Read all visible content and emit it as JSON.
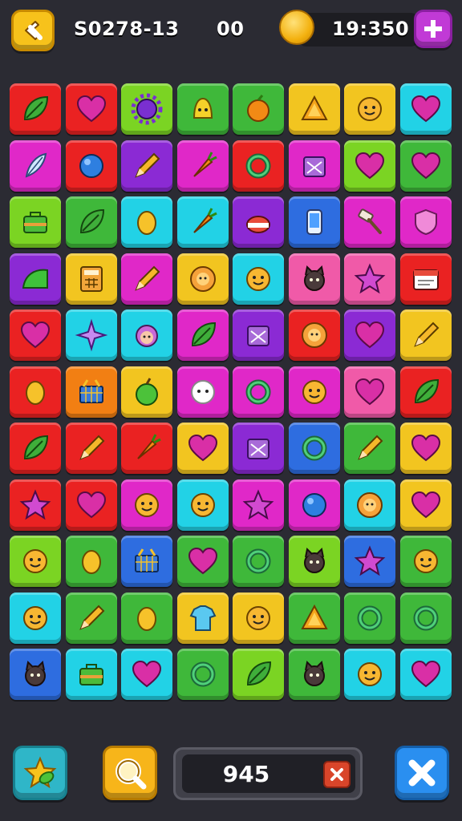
{
  "header": {
    "left_code": "S0278-13",
    "mid_value": "00",
    "coins": "19:350"
  },
  "footer": {
    "score": "945"
  },
  "colors": {
    "red": "#ea2222",
    "magenta": "#e028c8",
    "lime": "#7bd423",
    "green": "#3fb83a",
    "yellow": "#f2c520",
    "cyan": "#22d2e6",
    "purple": "#8b2ad4",
    "orange": "#f27f13",
    "blue": "#2e6de0",
    "pink": "#f05aa8"
  },
  "board": {
    "rows": [
      [
        {
          "bg": "red",
          "icon": "leaf"
        },
        {
          "bg": "red",
          "icon": "heart"
        },
        {
          "bg": "lime",
          "icon": "gear"
        },
        {
          "bg": "green",
          "icon": "bell"
        },
        {
          "bg": "green",
          "icon": "orange"
        },
        {
          "bg": "yellow",
          "icon": "triangle"
        },
        {
          "bg": "yellow",
          "icon": "face"
        },
        {
          "bg": "cyan",
          "icon": "heart"
        }
      ],
      [
        {
          "bg": "magenta",
          "icon": "feather"
        },
        {
          "bg": "red",
          "icon": "ball"
        },
        {
          "bg": "purple",
          "icon": "pencil"
        },
        {
          "bg": "magenta",
          "icon": "carrot"
        },
        {
          "bg": "red",
          "icon": "ring"
        },
        {
          "bg": "magenta",
          "icon": "box"
        },
        {
          "bg": "lime",
          "icon": "heart"
        },
        {
          "bg": "green",
          "icon": "heart"
        }
      ],
      [
        {
          "bg": "lime",
          "icon": "bag"
        },
        {
          "bg": "green",
          "icon": "leaf"
        },
        {
          "bg": "cyan",
          "icon": "egg"
        },
        {
          "bg": "cyan",
          "icon": "carrot"
        },
        {
          "bg": "purple",
          "icon": "pot"
        },
        {
          "bg": "blue",
          "icon": "phone"
        },
        {
          "bg": "magenta",
          "icon": "hammer"
        },
        {
          "bg": "magenta",
          "icon": "shield"
        }
      ],
      [
        {
          "bg": "purple",
          "icon": "slice"
        },
        {
          "bg": "yellow",
          "icon": "calc"
        },
        {
          "bg": "magenta",
          "icon": "pencil"
        },
        {
          "bg": "yellow",
          "icon": "flower"
        },
        {
          "bg": "cyan",
          "icon": "face"
        },
        {
          "bg": "pink",
          "icon": "cat"
        },
        {
          "bg": "pink",
          "icon": "star"
        },
        {
          "bg": "red",
          "icon": "card"
        }
      ],
      [
        {
          "bg": "red",
          "icon": "heart"
        },
        {
          "bg": "cyan",
          "icon": "sparkle"
        },
        {
          "bg": "cyan",
          "icon": "girl"
        },
        {
          "bg": "magenta",
          "icon": "leaf"
        },
        {
          "bg": "purple",
          "icon": "box"
        },
        {
          "bg": "red",
          "icon": "flower"
        },
        {
          "bg": "purple",
          "icon": "heart"
        },
        {
          "bg": "yellow",
          "icon": "pencil"
        }
      ],
      [
        {
          "bg": "red",
          "icon": "egg"
        },
        {
          "bg": "orange",
          "icon": "basket"
        },
        {
          "bg": "yellow",
          "icon": "apple"
        },
        {
          "bg": "magenta",
          "icon": "ghost"
        },
        {
          "bg": "magenta",
          "icon": "ring"
        },
        {
          "bg": "magenta",
          "icon": "face"
        },
        {
          "bg": "pink",
          "icon": "heart"
        },
        {
          "bg": "red",
          "icon": "leaf"
        }
      ],
      [
        {
          "bg": "red",
          "icon": "leaf"
        },
        {
          "bg": "red",
          "icon": "pencil"
        },
        {
          "bg": "red",
          "icon": "carrot"
        },
        {
          "bg": "yellow",
          "icon": "heart"
        },
        {
          "bg": "purple",
          "icon": "box"
        },
        {
          "bg": "blue",
          "icon": "ring"
        },
        {
          "bg": "green",
          "icon": "pencil"
        },
        {
          "bg": "yellow",
          "icon": "heart"
        }
      ],
      [
        {
          "bg": "red",
          "icon": "star"
        },
        {
          "bg": "red",
          "icon": "heart"
        },
        {
          "bg": "magenta",
          "icon": "face"
        },
        {
          "bg": "cyan",
          "icon": "face"
        },
        {
          "bg": "magenta",
          "icon": "star"
        },
        {
          "bg": "magenta",
          "icon": "ball"
        },
        {
          "bg": "cyan",
          "icon": "flower"
        },
        {
          "bg": "yellow",
          "icon": "heart"
        }
      ],
      [
        {
          "bg": "lime",
          "icon": "face"
        },
        {
          "bg": "green",
          "icon": "egg"
        },
        {
          "bg": "blue",
          "icon": "basket"
        },
        {
          "bg": "green",
          "icon": "heart"
        },
        {
          "bg": "green",
          "icon": "ring"
        },
        {
          "bg": "lime",
          "icon": "cat"
        },
        {
          "bg": "blue",
          "icon": "star"
        },
        {
          "bg": "green",
          "icon": "face"
        }
      ],
      [
        {
          "bg": "cyan",
          "icon": "face"
        },
        {
          "bg": "green",
          "icon": "pencil"
        },
        {
          "bg": "green",
          "icon": "egg"
        },
        {
          "bg": "yellow",
          "icon": "shirt"
        },
        {
          "bg": "yellow",
          "icon": "face"
        },
        {
          "bg": "green",
          "icon": "triangle"
        },
        {
          "bg": "green",
          "icon": "ring"
        },
        {
          "bg": "green",
          "icon": "ring"
        }
      ],
      [
        {
          "bg": "blue",
          "icon": "cat"
        },
        {
          "bg": "cyan",
          "icon": "bag"
        },
        {
          "bg": "cyan",
          "icon": "heart"
        },
        {
          "bg": "green",
          "icon": "ring"
        },
        {
          "bg": "lime",
          "icon": "leaf"
        },
        {
          "bg": "green",
          "icon": "cat"
        },
        {
          "bg": "cyan",
          "icon": "face"
        },
        {
          "bg": "cyan",
          "icon": "heart"
        }
      ]
    ]
  },
  "icons": {
    "back": "back-arrow-icon",
    "plus": "plus-icon",
    "coin": "coin-icon",
    "star_leaf": "star-leaf-icon",
    "magnify": "magnifier-icon",
    "close": "close-icon"
  }
}
